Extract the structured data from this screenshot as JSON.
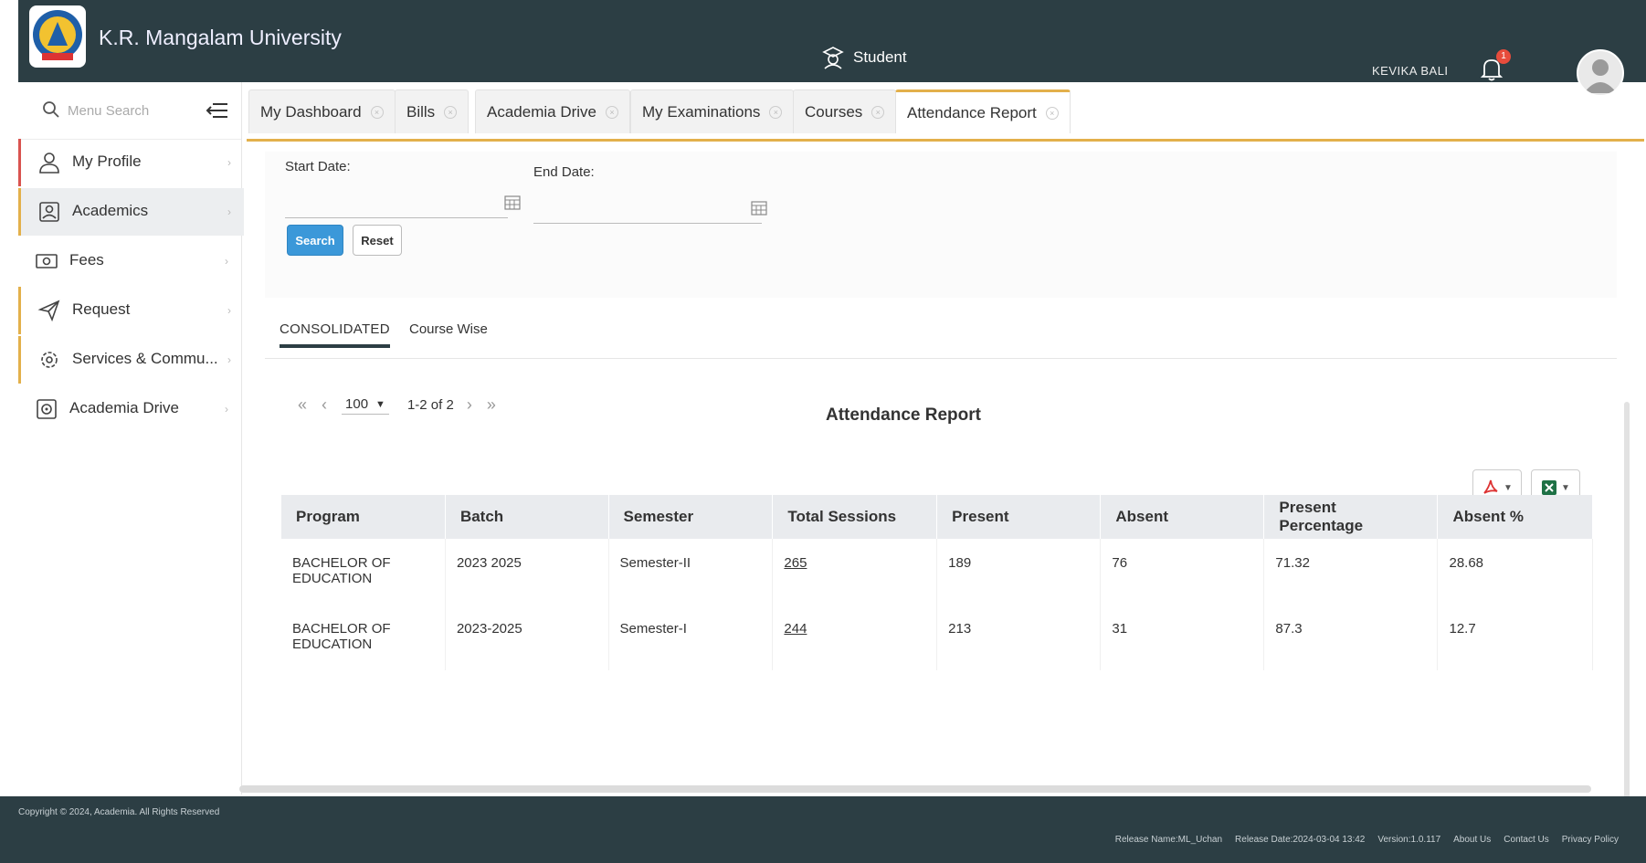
{
  "header": {
    "university_name": "K.R. Mangalam University",
    "role": "Student",
    "user_name": "KEVIKA BALI",
    "notification_count": "1"
  },
  "sidebar": {
    "search_placeholder": "Menu Search",
    "items": [
      {
        "label": "My Profile",
        "icon": "user-icon"
      },
      {
        "label": "Academics",
        "icon": "id-card-icon"
      },
      {
        "label": "Fees",
        "icon": "money-icon"
      },
      {
        "label": "Request",
        "icon": "send-icon"
      },
      {
        "label": "Services & Commu...",
        "icon": "gear-icon"
      },
      {
        "label": "Academia Drive",
        "icon": "drive-icon"
      }
    ]
  },
  "tabs": [
    {
      "label": "My Dashboard"
    },
    {
      "label": "Bills"
    },
    {
      "label": "Academia Drive"
    },
    {
      "label": "My Examinations"
    },
    {
      "label": "Courses"
    },
    {
      "label": "Attendance Report"
    }
  ],
  "filter": {
    "start_label": "Start Date:",
    "end_label": "End Date:",
    "start_value": "",
    "end_value": "",
    "search_label": "Search",
    "reset_label": "Reset"
  },
  "subtabs": {
    "consolidated": "CONSOLIDATED",
    "course_wise": "Course Wise"
  },
  "pager": {
    "page_size": "100",
    "range": "1-2 of 2"
  },
  "report_title": "Attendance Report",
  "table": {
    "columns": [
      "Program",
      "Batch",
      "Semester",
      "Total Sessions",
      "Present",
      "Absent",
      "Present Percentage",
      "Absent %"
    ],
    "rows": [
      {
        "program": "BACHELOR OF EDUCATION",
        "batch": "2023 2025",
        "semester": "Semester-II",
        "total": "265",
        "present": "189",
        "absent": "76",
        "present_pct": "71.32",
        "absent_pct": "28.68"
      },
      {
        "program": "BACHELOR OF EDUCATION",
        "batch": "2023-2025",
        "semester": "Semester-I",
        "total": "244",
        "present": "213",
        "absent": "31",
        "present_pct": "87.3",
        "absent_pct": "12.7"
      }
    ]
  },
  "footer": {
    "copyright": "Copyright © 2024, Academia. All Rights Reserved",
    "release_name": "Release Name:ML_Uchan",
    "release_date": "Release Date:2024-03-04 13:42",
    "version": "Version:1.0.117",
    "about": "About Us",
    "contact": "Contact Us",
    "privacy": "Privacy Policy"
  },
  "colors": {
    "header_bg": "#2c3e44",
    "accent": "#e3b04b",
    "primary_button": "#3b98d9"
  }
}
